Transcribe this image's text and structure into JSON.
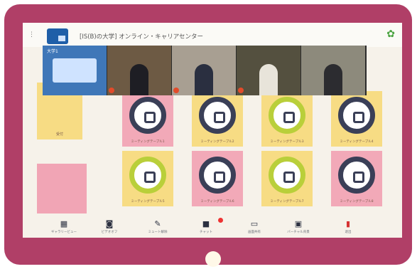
{
  "header": {
    "menu_icon": "menu-dots-icon",
    "title": "[IS(B)の大学] オンライン・キャリアセンター",
    "settings_icon": "gear-icon"
  },
  "video_tiles": [
    {
      "label": "大学1"
    },
    {
      "label": ""
    },
    {
      "label": ""
    },
    {
      "label": ""
    },
    {
      "label": ""
    }
  ],
  "rooms": [
    {
      "caption": "受付"
    },
    {
      "caption": ""
    }
  ],
  "tables": [
    {
      "caption": "ミーティングテーブル1"
    },
    {
      "caption": "ミーティングテーブル2"
    },
    {
      "caption": "ミーティングテーブル3"
    },
    {
      "caption": "ミーティングテーブル4"
    },
    {
      "caption": "ミーティングテーブル5"
    },
    {
      "caption": "ミーティングテーブル6"
    },
    {
      "caption": "ミーティングテーブル7"
    },
    {
      "caption": "ミーティングテーブル8"
    }
  ],
  "toolbar": [
    {
      "icon": "grid-icon",
      "label": "ギャラリービュー"
    },
    {
      "icon": "camera-off-icon",
      "label": "ビデオオフ"
    },
    {
      "icon": "mic-off-icon",
      "label": "ミュート解除"
    },
    {
      "icon": "chat-icon",
      "label": "チャット"
    },
    {
      "icon": "screen-share-icon",
      "label": "画面共有"
    },
    {
      "icon": "virtual-bg-icon",
      "label": "バーチャル背景"
    },
    {
      "icon": "leave-icon",
      "label": "退出"
    }
  ]
}
